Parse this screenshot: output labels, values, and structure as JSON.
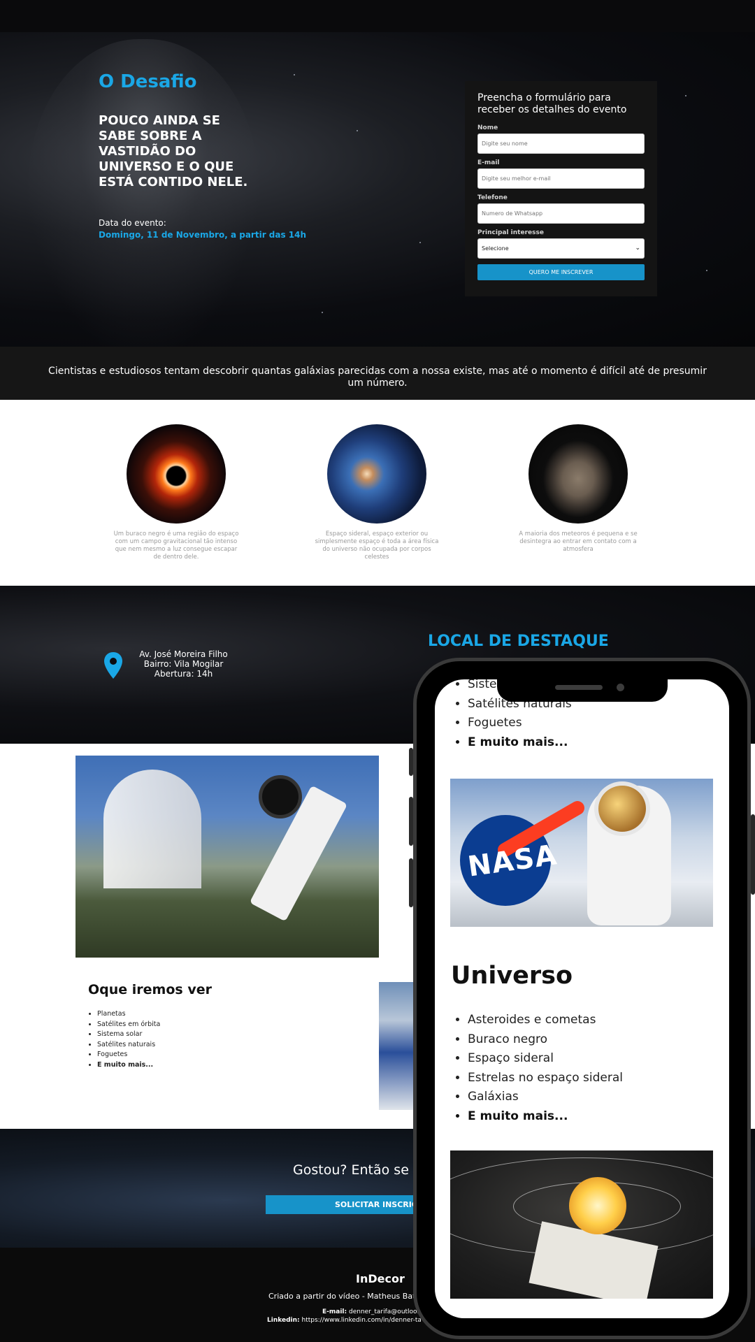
{
  "hero": {
    "title": "O Desafio",
    "headline": "POUCO AINDA SE SABE SOBRE A VASTIDÃO DO UNIVERSO E O QUE ESTÁ CONTIDO NELE.",
    "date_label": "Data do evento:",
    "date_value": "Domingo, 11 de Novembro, a partir das 14h"
  },
  "form": {
    "title": "Preencha o formulário para receber os detalhes do evento",
    "name_label": "Nome",
    "name_placeholder": "Digite seu nome",
    "email_label": "E-mail",
    "email_placeholder": "Digite seu melhor e-mail",
    "phone_label": "Telefone",
    "phone_placeholder": "Numero de Whatsapp",
    "interest_label": "Principal interesse",
    "interest_selected": "Selecione",
    "submit_label": "QUERO ME INSCREVER"
  },
  "banner": {
    "text": "Cientistas e estudiosos tentam descobrir quantas galáxias parecidas com a nossa existe, mas até o momento é difícil até de presumir um número."
  },
  "cards": [
    {
      "text": "Um buraco negro é uma região do espaço com um campo gravitacional tão intenso que nem mesmo a luz consegue escapar de dentro dele."
    },
    {
      "text": "Espaço sideral, espaço exterior ou simplesmente espaço é toda a área física do universo não ocupada por corpos celestes"
    },
    {
      "text": "A maioria dos meteoros é pequena e se desintegra ao entrar em contato com a atmosfera"
    }
  ],
  "location": {
    "address_line1": "Av. José Moreira Filho",
    "address_line2": "Bairro: Vila Mogilar",
    "address_line3": "Abertura: 14h",
    "title": "LOCAL DE DESTAQUE",
    "pin_icon": "map-pin-icon",
    "pin_color": "#1aa7e6"
  },
  "see": {
    "title": "Oque iremos ver",
    "items": [
      "Planetas",
      "Satélites em órbita",
      "Sistema solar",
      "Satélites naturais",
      "Foguetes",
      "E muito mais..."
    ]
  },
  "cta": {
    "text": "Gostou? Então se i",
    "button_label": "SOLICITAR INSCRIÇ"
  },
  "footer": {
    "brand": "InDecor",
    "credit": "Criado a partir do vídeo - Matheus Bat",
    "email_label": "E-mail:",
    "email_value": "denner_tarifa@outlool",
    "linkedin_label": "Linkedin:",
    "linkedin_value": "https://www.linkedin.com/in/denner-ta"
  },
  "phone": {
    "top_list": [
      "Sistem",
      "Satélites naturais",
      "Foguetes",
      "E muito mais..."
    ],
    "heading": "Universo",
    "universe_list": [
      "Asteroides e cometas",
      "Buraco negro",
      "Espaço sideral",
      "Estrelas no espaço sideral",
      "Galáxias",
      "E muito mais..."
    ],
    "nasa_text": "NASA"
  },
  "colors": {
    "accent": "#1aa7e6",
    "button": "#1793c9",
    "dark_bg": "#0a0a0c"
  }
}
